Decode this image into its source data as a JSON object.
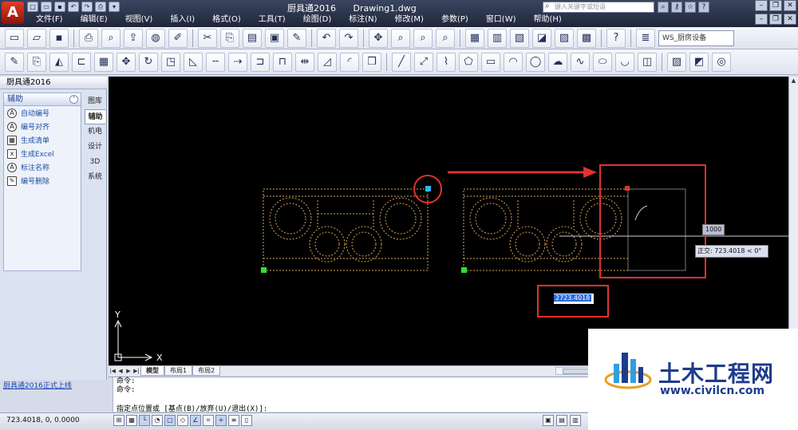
{
  "app": {
    "logo_letter": "A",
    "doc_titles": [
      "厨具通2016",
      "Drawing1.dwg"
    ],
    "search_placeholder": "键入关键字或短语"
  },
  "menu": [
    "文件(F)",
    "编辑(E)",
    "视图(V)",
    "插入(I)",
    "格式(O)",
    "工具(T)",
    "绘图(D)",
    "标注(N)",
    "修改(M)",
    "参数(P)",
    "窗口(W)",
    "帮助(H)"
  ],
  "toolbar1": {
    "layer_name": "WS_厨房设备"
  },
  "left_panel": {
    "header": "厨具通2016",
    "section_title": "辅助",
    "items": [
      {
        "icon": "A",
        "label": "自动编号"
      },
      {
        "icon": "A",
        "label": "编号对齐"
      },
      {
        "icon": "▦",
        "label": "生成清单"
      },
      {
        "icon": "x",
        "label": "生成Excel"
      },
      {
        "icon": "A",
        "label": "标注名称"
      },
      {
        "icon": "✎",
        "label": "编号删除"
      }
    ],
    "side_tabs": [
      "图库",
      "辅助",
      "机电",
      "设计",
      "3D",
      "系统"
    ],
    "active_tab_index": 1,
    "footer_link": "厨具通2016正式上线"
  },
  "canvas": {
    "background": "#000000",
    "ucs_x": "X",
    "ucs_y": "Y",
    "dynamic_length": "1000",
    "polar_tooltip": "正交: 723.4018 < 0°",
    "dynamic_input_value": "2723.4018"
  },
  "layout_tabs": [
    "模型",
    "布局1",
    "布局2"
  ],
  "active_layout": 0,
  "command_lines": [
    "命令:",
    "命令:"
  ],
  "command_prompt": "指定点位置或 [基点(B)/放弃(U)/退出(X)]:",
  "status": {
    "coord_x": "723.4018",
    "coord_y": "0",
    "coord_z": "0.0000"
  },
  "watermark": {
    "cn_text": "土木工程网",
    "url": "www.civilcn.com"
  },
  "colors": {
    "annotation_red": "#e0322e",
    "grip_blue": "#30b7ee",
    "grip_green": "#2ee02e",
    "arrow_red": "#e0322e",
    "drawing_orange": "#d8a35c"
  }
}
